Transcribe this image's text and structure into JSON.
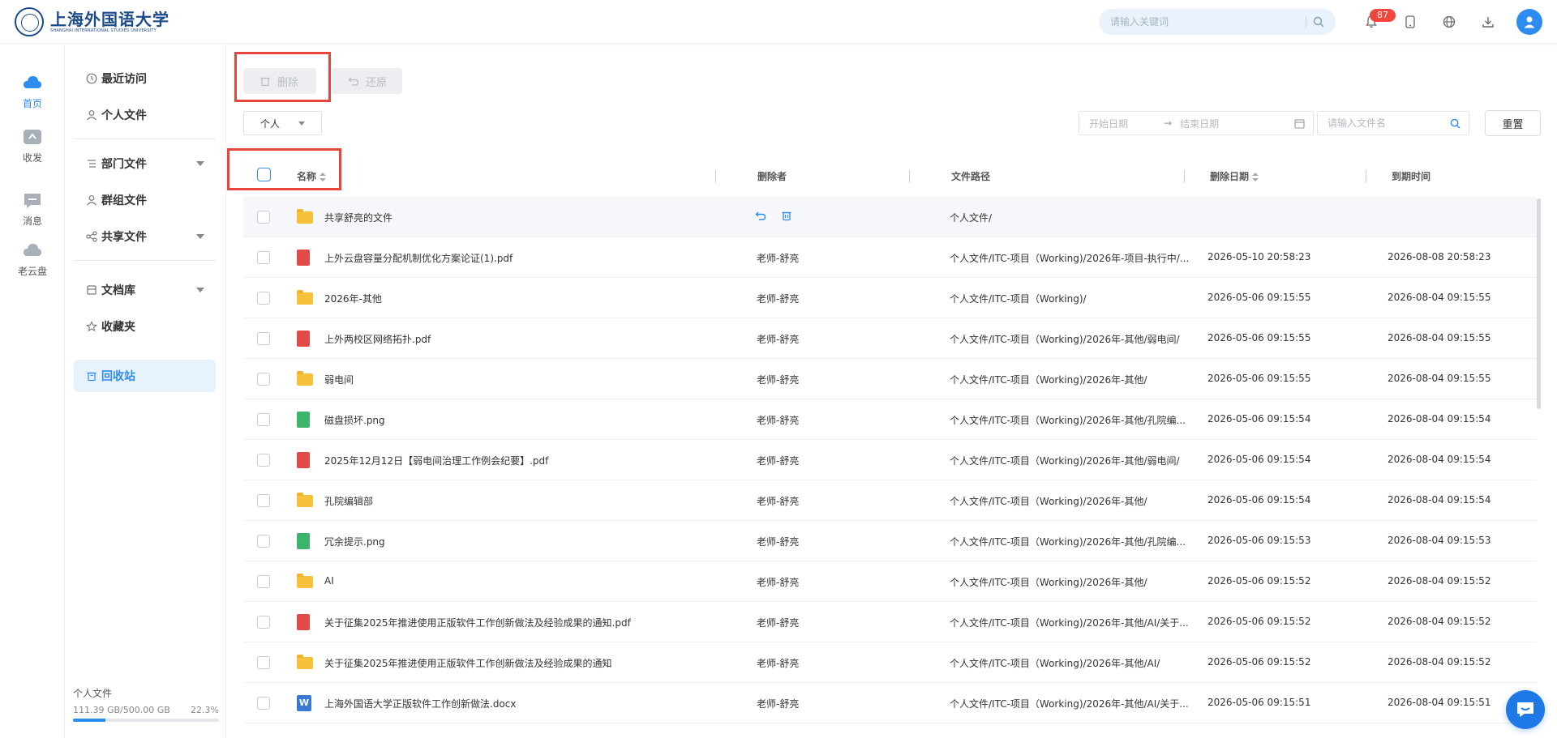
{
  "header": {
    "logo_cn": "上海外国语大学",
    "logo_en": "SHANGHAI INTERNATIONAL STUDIES UNIVERSITY",
    "search_placeholder": "请输入关键词",
    "notification_count": "87"
  },
  "rail": [
    {
      "label": "首页",
      "icon": "home-cloud-icon",
      "active": true
    },
    {
      "label": "收发",
      "icon": "send-receive-icon",
      "active": false
    },
    {
      "label": "消息",
      "icon": "message-icon",
      "active": false
    },
    {
      "label": "老云盘",
      "icon": "old-cloud-icon",
      "active": false
    }
  ],
  "sidebar": {
    "items": [
      {
        "label": "最近访问",
        "icon": "clock-icon"
      },
      {
        "label": "个人文件",
        "icon": "user-icon"
      },
      {
        "label": "部门文件",
        "icon": "list-icon",
        "expandable": true
      },
      {
        "label": "群组文件",
        "icon": "group-icon"
      },
      {
        "label": "共享文件",
        "icon": "share-icon",
        "expandable": true
      },
      {
        "label": "文档库",
        "icon": "library-icon",
        "expandable": true
      },
      {
        "label": "收藏夹",
        "icon": "star-icon"
      },
      {
        "label": "回收站",
        "icon": "trash-icon",
        "active": true
      }
    ],
    "quota": {
      "label": "个人文件",
      "used": "111.39 GB/500.00 GB",
      "percent": "22.3%",
      "fraction": 0.223
    }
  },
  "toolbar": {
    "delete_label": "删除",
    "restore_label": "还原",
    "scope_select": "个人",
    "date_start_placeholder": "开始日期",
    "date_end_placeholder": "结束日期",
    "filename_placeholder": "请输入文件名",
    "reset_label": "重置"
  },
  "table": {
    "columns": {
      "name": "名称",
      "deleter": "删除者",
      "path": "文件路径",
      "deleted_date": "删除日期",
      "expire": "到期时间"
    },
    "rows": [
      {
        "type": "folder",
        "name": "共享舒亮的文件",
        "deleter": "",
        "path": "个人文件/",
        "deleted": "",
        "expire": "",
        "hover": true
      },
      {
        "type": "pdf",
        "name": "上外云盘容量分配机制优化方案论证(1).pdf",
        "deleter": "老师-舒亮",
        "path": "个人文件/ITC-项目（Working)/2026年-项目-执行中/...",
        "deleted": "2026-05-10 20:58:23",
        "expire": "2026-08-08 20:58:23"
      },
      {
        "type": "folder",
        "name": "2026年-其他",
        "deleter": "老师-舒亮",
        "path": "个人文件/ITC-项目（Working)/",
        "deleted": "2026-05-06 09:15:55",
        "expire": "2026-08-04 09:15:55"
      },
      {
        "type": "pdf",
        "name": "上外两校区网络拓扑.pdf",
        "deleter": "老师-舒亮",
        "path": "个人文件/ITC-项目（Working)/2026年-其他/弱电间/",
        "deleted": "2026-05-06 09:15:55",
        "expire": "2026-08-04 09:15:55"
      },
      {
        "type": "folder",
        "name": "弱电间",
        "deleter": "老师-舒亮",
        "path": "个人文件/ITC-项目（Working)/2026年-其他/",
        "deleted": "2026-05-06 09:15:55",
        "expire": "2026-08-04 09:15:55"
      },
      {
        "type": "img",
        "name": "磁盘损坏.png",
        "deleter": "老师-舒亮",
        "path": "个人文件/ITC-项目（Working)/2026年-其他/孔院编...",
        "deleted": "2026-05-06 09:15:54",
        "expire": "2026-08-04 09:15:54"
      },
      {
        "type": "pdf",
        "name": "2025年12月12日【弱电间治理工作例会纪要】.pdf",
        "deleter": "老师-舒亮",
        "path": "个人文件/ITC-项目（Working)/2026年-其他/弱电间/",
        "deleted": "2026-05-06 09:15:54",
        "expire": "2026-08-04 09:15:54"
      },
      {
        "type": "folder",
        "name": "孔院编辑部",
        "deleter": "老师-舒亮",
        "path": "个人文件/ITC-项目（Working)/2026年-其他/",
        "deleted": "2026-05-06 09:15:54",
        "expire": "2026-08-04 09:15:54"
      },
      {
        "type": "img",
        "name": "冗余提示.png",
        "deleter": "老师-舒亮",
        "path": "个人文件/ITC-项目（Working)/2026年-其他/孔院编...",
        "deleted": "2026-05-06 09:15:53",
        "expire": "2026-08-04 09:15:53"
      },
      {
        "type": "folder",
        "name": "AI",
        "deleter": "老师-舒亮",
        "path": "个人文件/ITC-项目（Working)/2026年-其他/",
        "deleted": "2026-05-06 09:15:52",
        "expire": "2026-08-04 09:15:52"
      },
      {
        "type": "pdf",
        "name": "关于征集2025年推进使用正版软件工作创新做法及经验成果的通知.pdf",
        "deleter": "老师-舒亮",
        "path": "个人文件/ITC-项目（Working)/2026年-其他/AI/关于...",
        "deleted": "2026-05-06 09:15:52",
        "expire": "2026-08-04 09:15:52"
      },
      {
        "type": "folder",
        "name": "关于征集2025年推进使用正版软件工作创新做法及经验成果的通知",
        "deleter": "老师-舒亮",
        "path": "个人文件/ITC-项目（Working)/2026年-其他/AI/",
        "deleted": "2026-05-06 09:15:52",
        "expire": "2026-08-04 09:15:52"
      },
      {
        "type": "doc",
        "name": "上海外国语大学正版软件工作创新做法.docx",
        "deleter": "老师-舒亮",
        "path": "个人文件/ITC-项目（Working)/2026年-其他/AI/关于...",
        "deleted": "2026-05-06 09:15:51",
        "expire": "2026-08-04 09:15:51"
      }
    ]
  },
  "colors": {
    "accent": "#2d8cf0",
    "highlight_box": "#e5463c",
    "badge": "#f0463c"
  }
}
